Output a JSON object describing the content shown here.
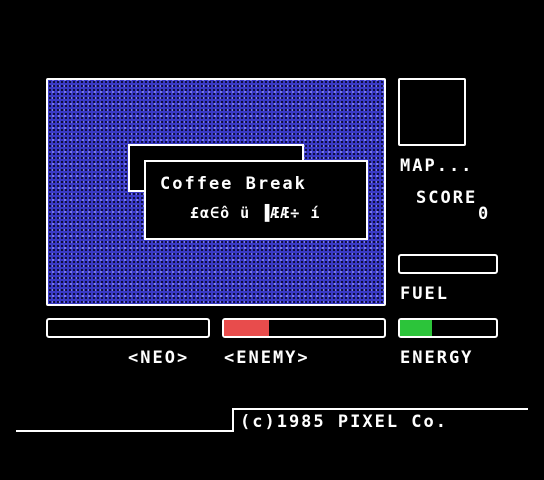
{
  "dialog": {
    "title": "Coffee Break",
    "subtitle": "£α∈ô ü ▐ÆÆ÷ í"
  },
  "sidebar": {
    "map_label": "MAP...",
    "score_label": "SCORE",
    "score_value": "0",
    "fuel_label": "FUEL"
  },
  "bars": {
    "neo_label": "<NEO>",
    "enemy_label": "<ENEMY>",
    "energy_label": "ENERGY",
    "neo_level": 0,
    "enemy_level": 0.28,
    "energy_level": 0.33,
    "fuel_level": 0
  },
  "footer": {
    "copyright": "(c)1985 PIXEL Co."
  },
  "colors": {
    "playfield": "#3a3ac6",
    "enemy_fill": "#e84c4c",
    "energy_fill": "#2cc43a"
  }
}
